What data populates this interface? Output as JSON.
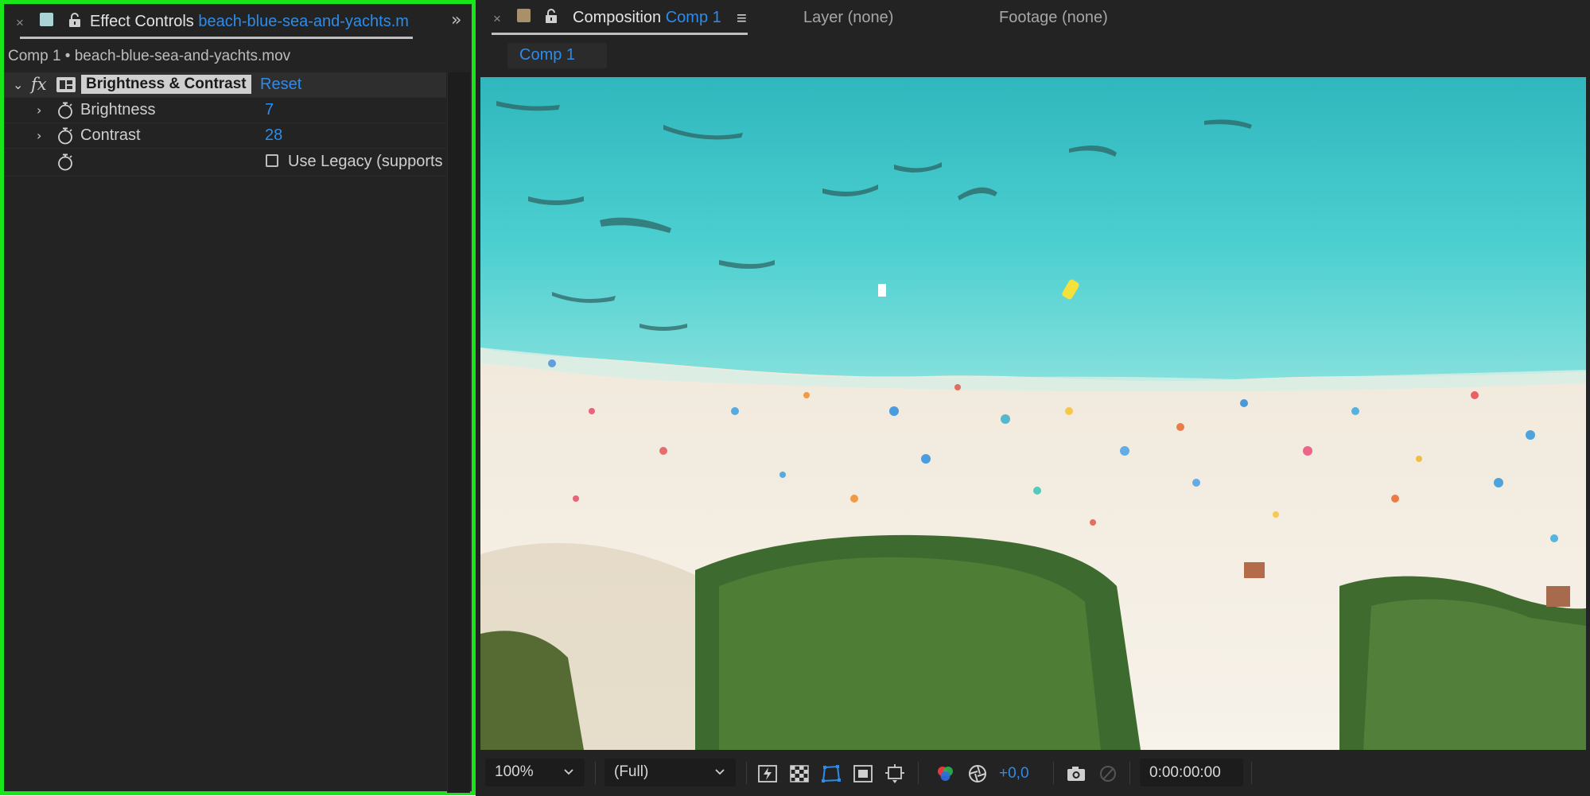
{
  "effect_controls": {
    "tab": {
      "close": "×",
      "title": "Effect Controls",
      "layer": "beach-blue-sea-and-yachts.m",
      "overflow": "»"
    },
    "subtitle": "Comp 1 • beach-blue-sea-and-yachts.mov",
    "effect": {
      "fx_label": "fx",
      "name": "Brightness & Contrast",
      "reset_label": "Reset"
    },
    "properties": [
      {
        "label": "Brightness",
        "value": "7"
      },
      {
        "label": "Contrast",
        "value": "28"
      }
    ],
    "use_legacy_label": "Use Legacy (supports"
  },
  "composition": {
    "tab": {
      "close": "×",
      "title": "Composition",
      "comp": "Comp 1",
      "menu": "≡"
    },
    "layer_tab": "Layer (none)",
    "footage_tab": "Footage (none)",
    "active_comp": "Comp 1",
    "toolbar": {
      "zoom": "100%",
      "resolution": "(Full)",
      "exposure": "+0,0",
      "timecode": "0:00:00:00"
    }
  },
  "colors": {
    "accent": "#2d8ceb",
    "panel_bg": "#232323",
    "highlight_border": "#19e619",
    "effect_controls_label": "#a9d3d5",
    "composition_label": "#a8916a"
  }
}
